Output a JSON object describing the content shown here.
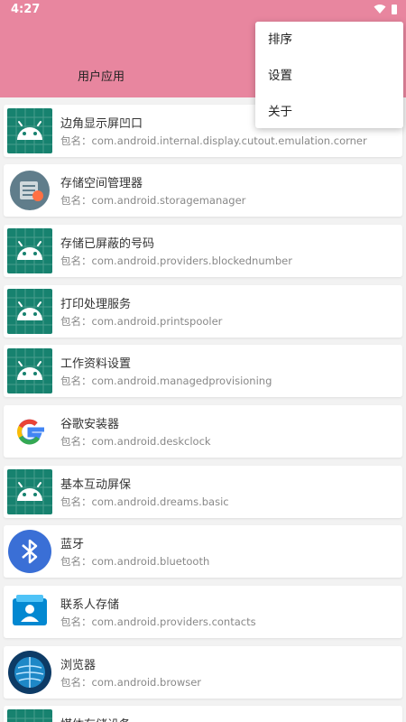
{
  "status_bar": {
    "time": "4:27",
    "icons": [
      "wifi-icon",
      "battery-icon"
    ]
  },
  "tabs": {
    "user_apps": "用户应用"
  },
  "menu": {
    "items": [
      {
        "label": "排序"
      },
      {
        "label": "设置"
      },
      {
        "label": "关于"
      }
    ]
  },
  "apps": [
    {
      "name": "边角显示屏凹口",
      "package": "包名：com.android.internal.display.cutout.emulation.corner",
      "icon": "android-icon"
    },
    {
      "name": "存储空间管理器",
      "package": "包名：com.android.storagemanager",
      "icon": "storage-manager-icon"
    },
    {
      "name": "存储已屏蔽的号码",
      "package": "包名：com.android.providers.blockednumber",
      "icon": "android-icon"
    },
    {
      "name": "打印处理服务",
      "package": "包名：com.android.printspooler",
      "icon": "android-icon"
    },
    {
      "name": "工作资料设置",
      "package": "包名：com.android.managedprovisioning",
      "icon": "android-icon"
    },
    {
      "name": "谷歌安装器",
      "package": "包名：com.android.deskclock",
      "icon": "google-icon"
    },
    {
      "name": "基本互动屏保",
      "package": "包名：com.android.dreams.basic",
      "icon": "android-icon"
    },
    {
      "name": "蓝牙",
      "package": "包名：com.android.bluetooth",
      "icon": "bluetooth-icon"
    },
    {
      "name": "联系人存储",
      "package": "包名：com.android.providers.contacts",
      "icon": "contacts-icon"
    },
    {
      "name": "浏览器",
      "package": "包名：com.android.browser",
      "icon": "browser-icon"
    },
    {
      "name": "媒体存储设备",
      "package": "",
      "icon": "android-icon"
    }
  ],
  "colors": {
    "accent": "#e8869f",
    "android_tile": "#17826f",
    "bluetooth": "#3a6fd6"
  }
}
